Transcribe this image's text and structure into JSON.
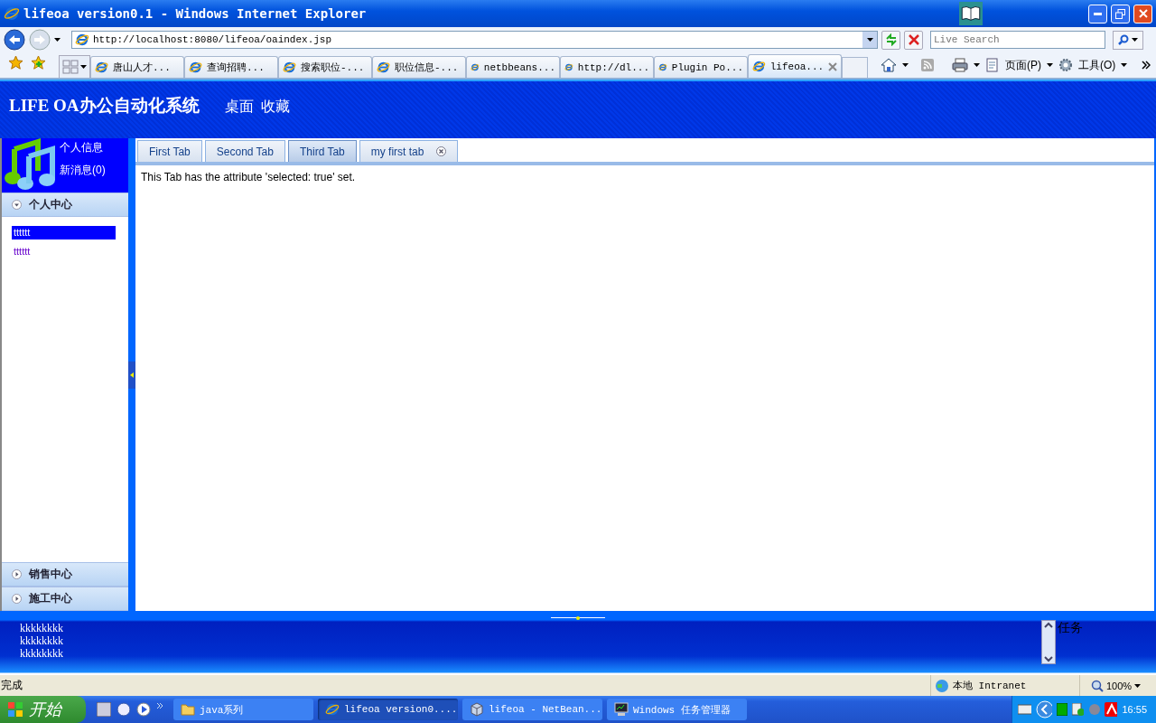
{
  "window": {
    "title": "lifeoa version0.1 - Windows Internet Explorer"
  },
  "address_bar": {
    "url": "http://localhost:8080/lifeoa/oaindex.jsp"
  },
  "search": {
    "placeholder": "Live Search"
  },
  "browser_tabs": [
    {
      "label": "唐山人才...",
      "selected": false
    },
    {
      "label": "查询招聘...",
      "selected": false
    },
    {
      "label": "搜索职位-...",
      "selected": false
    },
    {
      "label": "职位信息-...",
      "selected": false
    },
    {
      "label": "netbbeans...",
      "selected": false
    },
    {
      "label": "http://dl...",
      "selected": false
    },
    {
      "label": "Plugin Po...",
      "selected": false
    },
    {
      "label": "lifeoa...",
      "selected": true
    }
  ],
  "command_bar": [
    {
      "label": "页面(P)"
    },
    {
      "label": "工具(O)"
    }
  ],
  "app": {
    "title": "LIFE OA办公自动化系统",
    "nav": [
      "桌面",
      "收藏"
    ]
  },
  "user_panel": {
    "links": [
      "个人信息",
      "新消息(0)"
    ]
  },
  "accordion": [
    {
      "label": "个人中心",
      "expanded": true,
      "items": [
        {
          "label": "tttttt",
          "selected": true
        },
        {
          "label": "tttttt",
          "selected": false
        }
      ]
    },
    {
      "label": "销售中心",
      "expanded": false
    },
    {
      "label": "施工中心",
      "expanded": false
    }
  ],
  "content_tabs": [
    {
      "label": "First Tab",
      "selected": false,
      "closable": false
    },
    {
      "label": "Second Tab",
      "selected": false,
      "closable": false
    },
    {
      "label": "Third Tab",
      "selected": true,
      "closable": false
    },
    {
      "label": "my first tab",
      "selected": false,
      "closable": true
    }
  ],
  "content_text": "This Tab has the attribute 'selected: true' set.",
  "footer": {
    "lines": [
      "kkkkkkkk",
      "kkkkkkkk",
      "kkkkkkkk"
    ],
    "side_label": "任务"
  },
  "status_bar": {
    "text": "完成",
    "zone": "本地 Intranet",
    "zoom": "100%"
  },
  "taskbar": {
    "start": "开始",
    "tasks": [
      {
        "label": "java系列",
        "selected": false,
        "kind": "folder"
      },
      {
        "label": "lifeoa version0....",
        "selected": true,
        "kind": "browser"
      },
      {
        "label": "lifeoa - NetBean...",
        "selected": false,
        "kind": "ide"
      },
      {
        "label": "Windows 任务管理器",
        "selected": false,
        "kind": "monitor"
      }
    ],
    "clock": "16:55"
  }
}
